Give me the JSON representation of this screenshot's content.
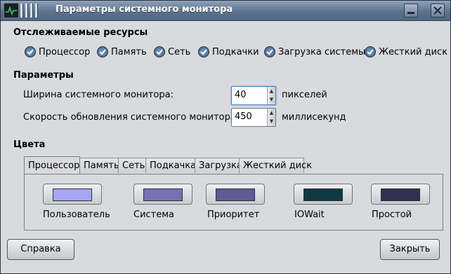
{
  "window": {
    "title": "Параметры системного монитора"
  },
  "resources": {
    "heading": "Отслеживаемые ресурсы",
    "items": [
      {
        "label": "Процессор",
        "checked": true
      },
      {
        "label": "Память",
        "checked": true
      },
      {
        "label": "Сеть",
        "checked": true
      },
      {
        "label": "Подкачки",
        "checked": true
      },
      {
        "label": "Загрузка системы",
        "checked": true
      },
      {
        "label": "Жесткий диск",
        "checked": true
      }
    ]
  },
  "parameters": {
    "heading": "Параметры",
    "width_label": "Ширина системного монитора:",
    "width_value": "40",
    "width_unit": "пикселей",
    "speed_label": "Скорость обновления системного монитора:",
    "speed_value": "450",
    "speed_unit": "миллисекунд"
  },
  "colors": {
    "heading": "Цвета",
    "tabs": [
      "Процессор",
      "Память",
      "Сеть",
      "Подкачка",
      "Загрузка",
      "Жесткий диск"
    ],
    "active_tab": "Процессор",
    "swatches": [
      {
        "label": "Пользователь",
        "color": "#a8a6f5"
      },
      {
        "label": "Система",
        "color": "#7771b4"
      },
      {
        "label": "Приоритет",
        "color": "#5f5b94"
      },
      {
        "label": "IOWait",
        "color": "#0d3a43"
      },
      {
        "label": "Простой",
        "color": "#333050"
      }
    ]
  },
  "buttons": {
    "help": "Справка",
    "close": "Закрыть"
  },
  "icons": {
    "app": "system-monitor-icon",
    "minimize": "minimize-icon",
    "close": "close-icon"
  }
}
